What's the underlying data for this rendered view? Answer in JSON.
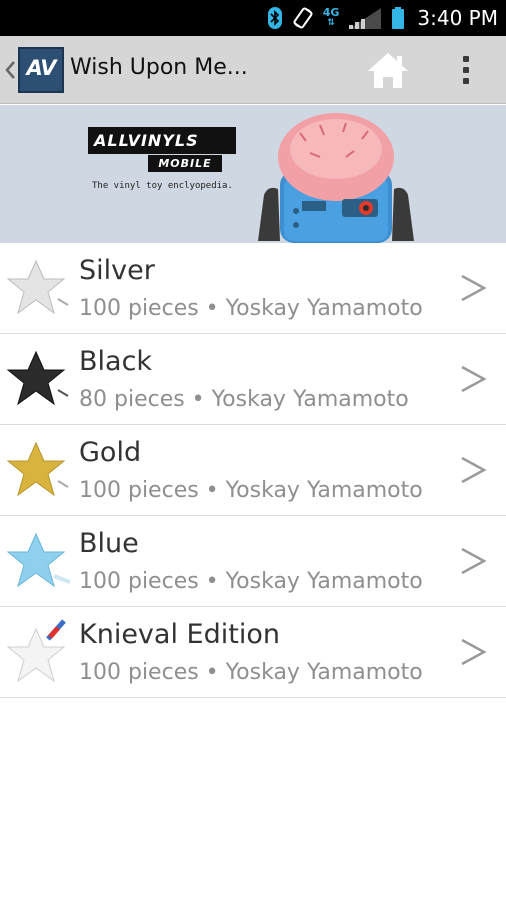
{
  "status_bar": {
    "time": "3:40 PM",
    "network": "4G",
    "icons": [
      "bluetooth-icon",
      "rotate-icon",
      "network-4g-icon",
      "signal-icon",
      "battery-icon"
    ]
  },
  "action_bar": {
    "title": "Wish Upon Me...",
    "logo_text": "AV",
    "icons": [
      "up-caret-icon",
      "home-icon",
      "overflow-menu-icon"
    ]
  },
  "banner": {
    "brand": "ALLVINYLS",
    "brand_sub": "MOBILE",
    "tagline": "The vinyl toy enclyopedia."
  },
  "items": [
    {
      "name": "Silver",
      "subtitle": "100 pieces • Yoskay Yamamoto",
      "star_color": "#e4e4e4"
    },
    {
      "name": "Black",
      "subtitle": "80 pieces • Yoskay Yamamoto",
      "star_color": "#2b2b2b"
    },
    {
      "name": "Gold",
      "subtitle": "100 pieces • Yoskay Yamamoto",
      "star_color": "#d8b43e"
    },
    {
      "name": "Blue",
      "subtitle": "100 pieces • Yoskay Yamamoto",
      "star_color": "#8fd0ee"
    },
    {
      "name": "Knieval Edition",
      "subtitle": "100 pieces • Yoskay Yamamoto",
      "star_color": "#f4f4f4"
    }
  ],
  "colors": {
    "action_bar_bg": "#d6d6d6",
    "status_bar_bg": "#000000",
    "accent_blue": "#33b5e5",
    "banner_bg": "#cfd7e2"
  }
}
